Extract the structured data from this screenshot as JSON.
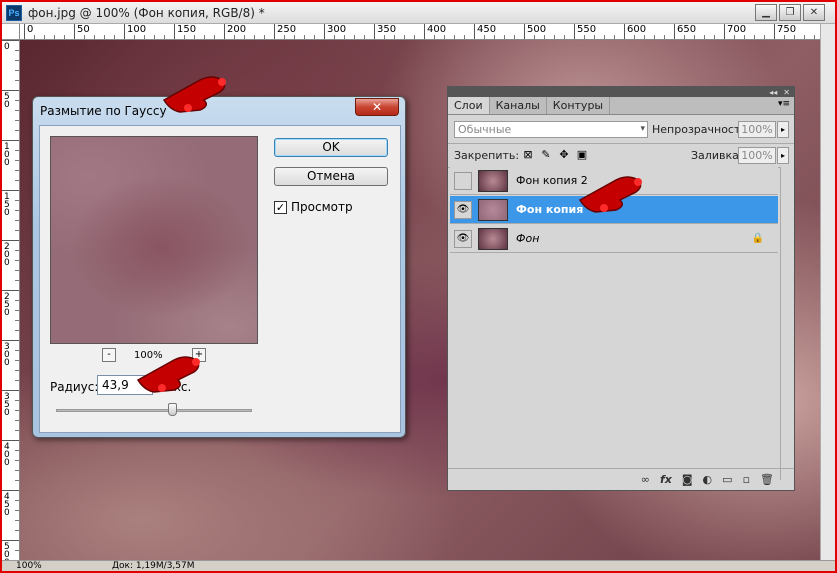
{
  "window": {
    "title": "фон.jpg @ 100% (Фон копия, RGB/8) *",
    "app_icon": "Ps",
    "buttons": {
      "minimize": "▁",
      "restore": "❐",
      "close": "✕"
    }
  },
  "rulers": {
    "top_labels": [
      "0",
      "50",
      "100",
      "150",
      "200",
      "250",
      "300",
      "350",
      "400",
      "450",
      "500",
      "550",
      "600",
      "650",
      "700",
      "750"
    ],
    "left_labels": [
      "0",
      "50",
      "100",
      "150",
      "200",
      "250",
      "300",
      "350",
      "400",
      "450",
      "500"
    ]
  },
  "status": {
    "zoom": "100%",
    "doc": "Док: 1,19M/3,57M"
  },
  "dialog": {
    "title": "Размытие по Гауссу",
    "close": "✕",
    "ok": "OK",
    "cancel": "Отмена",
    "preview_label": "Просмотр",
    "preview_checked": "✓",
    "zoom_out": "-",
    "zoom_in": "+",
    "zoom": "100%",
    "radius_label": "Радиус:",
    "radius_value": "43,9",
    "radius_unit": "пикс.",
    "radius_slider_fraction": 0.59
  },
  "layers_panel": {
    "collapse": "◂◂",
    "close": "✕",
    "tabs": [
      "Слои",
      "Каналы",
      "Контуры"
    ],
    "menu_icon": "▾≡",
    "blend_mode": "Обычные",
    "opacity_label": "Непрозрачность:",
    "opacity": "100%",
    "lock_label": "Закрепить:",
    "fill_label": "Заливка:",
    "fill": "100%",
    "layers": [
      {
        "name": "Фон копия 2",
        "visible": false,
        "selected": false,
        "locked": false
      },
      {
        "name": "Фон копия",
        "visible": true,
        "selected": true,
        "locked": false
      },
      {
        "name": "Фон",
        "visible": true,
        "selected": false,
        "locked": true
      }
    ],
    "eye_glyph": "👁",
    "lock_glyph": "🔒",
    "bottom_icons": [
      "link-icon",
      "fx-icon",
      "mask-icon",
      "adjustment-icon",
      "group-icon",
      "new-layer-icon",
      "trash-icon"
    ],
    "bottom_glyphs": [
      "∞",
      "fx",
      "◙",
      "◐",
      "▭",
      "▫",
      "🗑"
    ]
  },
  "colors": {
    "selected_layer": "#3d97e8",
    "frame": "#e00000"
  }
}
